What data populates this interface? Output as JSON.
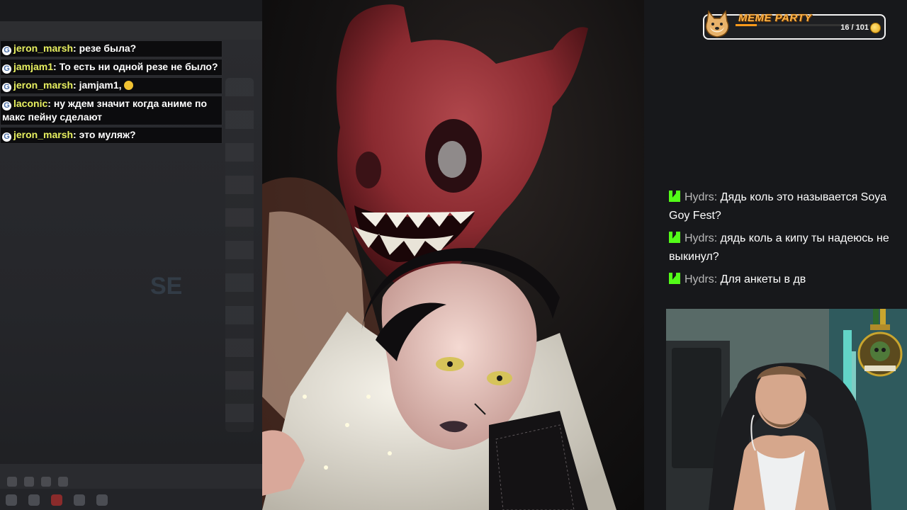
{
  "left_chat": [
    {
      "user": "jeron_marsh",
      "text": "резе была?",
      "badge": "G"
    },
    {
      "user": "jamjam1",
      "text": "То есть ни одной резе не было?",
      "badge": "G"
    },
    {
      "user": "jeron_marsh",
      "text": "jamjam1, ",
      "badge": "G",
      "emoji": "hugging-face-emoji"
    },
    {
      "user": "laconic",
      "text": "ну ждем значит когда аниме по макс пейну сделают",
      "badge": "G"
    },
    {
      "user": "jeron_marsh",
      "text": "это муляж?",
      "badge": "G"
    }
  ],
  "meme_party": {
    "title": "MEME PARTY",
    "count": "16 / 101",
    "progress": 0.158,
    "icon": "doge-icon",
    "coin_icon": "coin-icon"
  },
  "right_chat": [
    {
      "user": "Hydrs",
      "text": "Дядь коль это называется Soya Goy Fest?",
      "platform_icon": "kick-icon"
    },
    {
      "user": "Hydrs",
      "text": "дядь коль а кипу ты надеюсь не выкинул?",
      "platform_icon": "kick-icon"
    },
    {
      "user": "Hydrs",
      "text": "Для анкеты в дв",
      "platform_icon": "kick-icon"
    }
  ],
  "colors": {
    "left_username": "#e8f060",
    "right_username": "#b8b8b8",
    "kick_green": "#53fc18",
    "meme_orange": "#ffb347"
  }
}
